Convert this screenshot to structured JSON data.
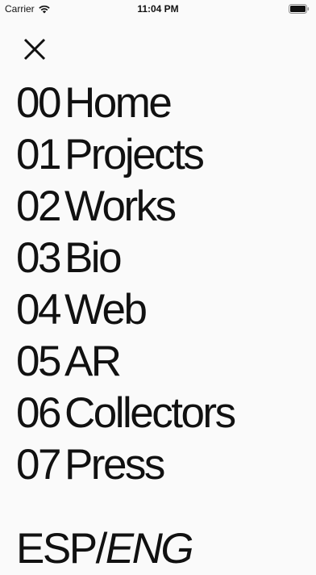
{
  "status_bar": {
    "carrier": "Carrier",
    "time": "11:04 PM",
    "wifi_icon": "wifi-icon",
    "battery_icon": "battery-icon"
  },
  "close_icon": "close-icon",
  "menu": {
    "items": [
      {
        "number": "00",
        "label": "Home"
      },
      {
        "number": "01",
        "label": "Projects"
      },
      {
        "number": "02",
        "label": "Works"
      },
      {
        "number": "03",
        "label": "Bio"
      },
      {
        "number": "04",
        "label": "Web"
      },
      {
        "number": "05",
        "label": "AR"
      },
      {
        "number": "06",
        "label": "Collectors"
      },
      {
        "number": "07",
        "label": "Press"
      }
    ]
  },
  "language": {
    "esp": "ESP",
    "separator": "/",
    "eng": "ENG",
    "active": "ENG"
  }
}
